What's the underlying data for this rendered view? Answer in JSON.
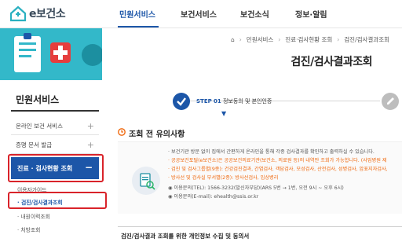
{
  "header": {
    "logo_text": "e보건소",
    "nav": [
      "민원서비스",
      "보건서비스",
      "보건소식",
      "정보·알림"
    ],
    "accent": "#1c56a8"
  },
  "banner": {
    "breadcrumb": [
      "민원서비스",
      "진료·검사현황 조회",
      "검진/검사결과조회"
    ],
    "title": "검진/검사결과조회",
    "color": "#33b8c9"
  },
  "sidebar": {
    "title": "민원서비스",
    "items": [
      {
        "label": "온라인 보건 서비스"
      },
      {
        "label": "증명 문서 발급"
      }
    ],
    "active_label": "진료 · 검사현황 조회",
    "subitems": [
      "이용자가이드",
      "검진/검사결과조회",
      "내원이력조회",
      "처방조회"
    ]
  },
  "steps": {
    "step_prefix": "STEP",
    "step_num": "01",
    "step_text": "정보동의 및 본인인증"
  },
  "notice": {
    "title": "조회 전 유의사항",
    "lines": [
      "보건기관 방문 없이 집에서 간편하게 온라인을 통해 각종 검사결과를 확인하고 출력하실 수 있습니다.",
      "공공보건포털(e보건소)은 공공보건의료기관(보건소, 의료원 등)의 내역만 조회가 가능합니다. (사업병원 제",
      "검진 및 검사그룹별(9종): 건강검진결과, 간염검사, 객담검사, 모성검사, 산전검사, 성병검사, 암표지자검사,",
      "방사선 및 검사실 부서별(2종): 방사선검사, 임상병리",
      "이용문의(TEL): 1566-3232(발신자부담)(ARS 5번 → 1번, 오전 9시 ~ 오후 6시)",
      "이용문의(E-mail): ehealth@ssis.or.kr"
    ]
  },
  "consent": {
    "title": "검진/검사결과 조회를 위한 개인정보 수집 및 동의서"
  }
}
